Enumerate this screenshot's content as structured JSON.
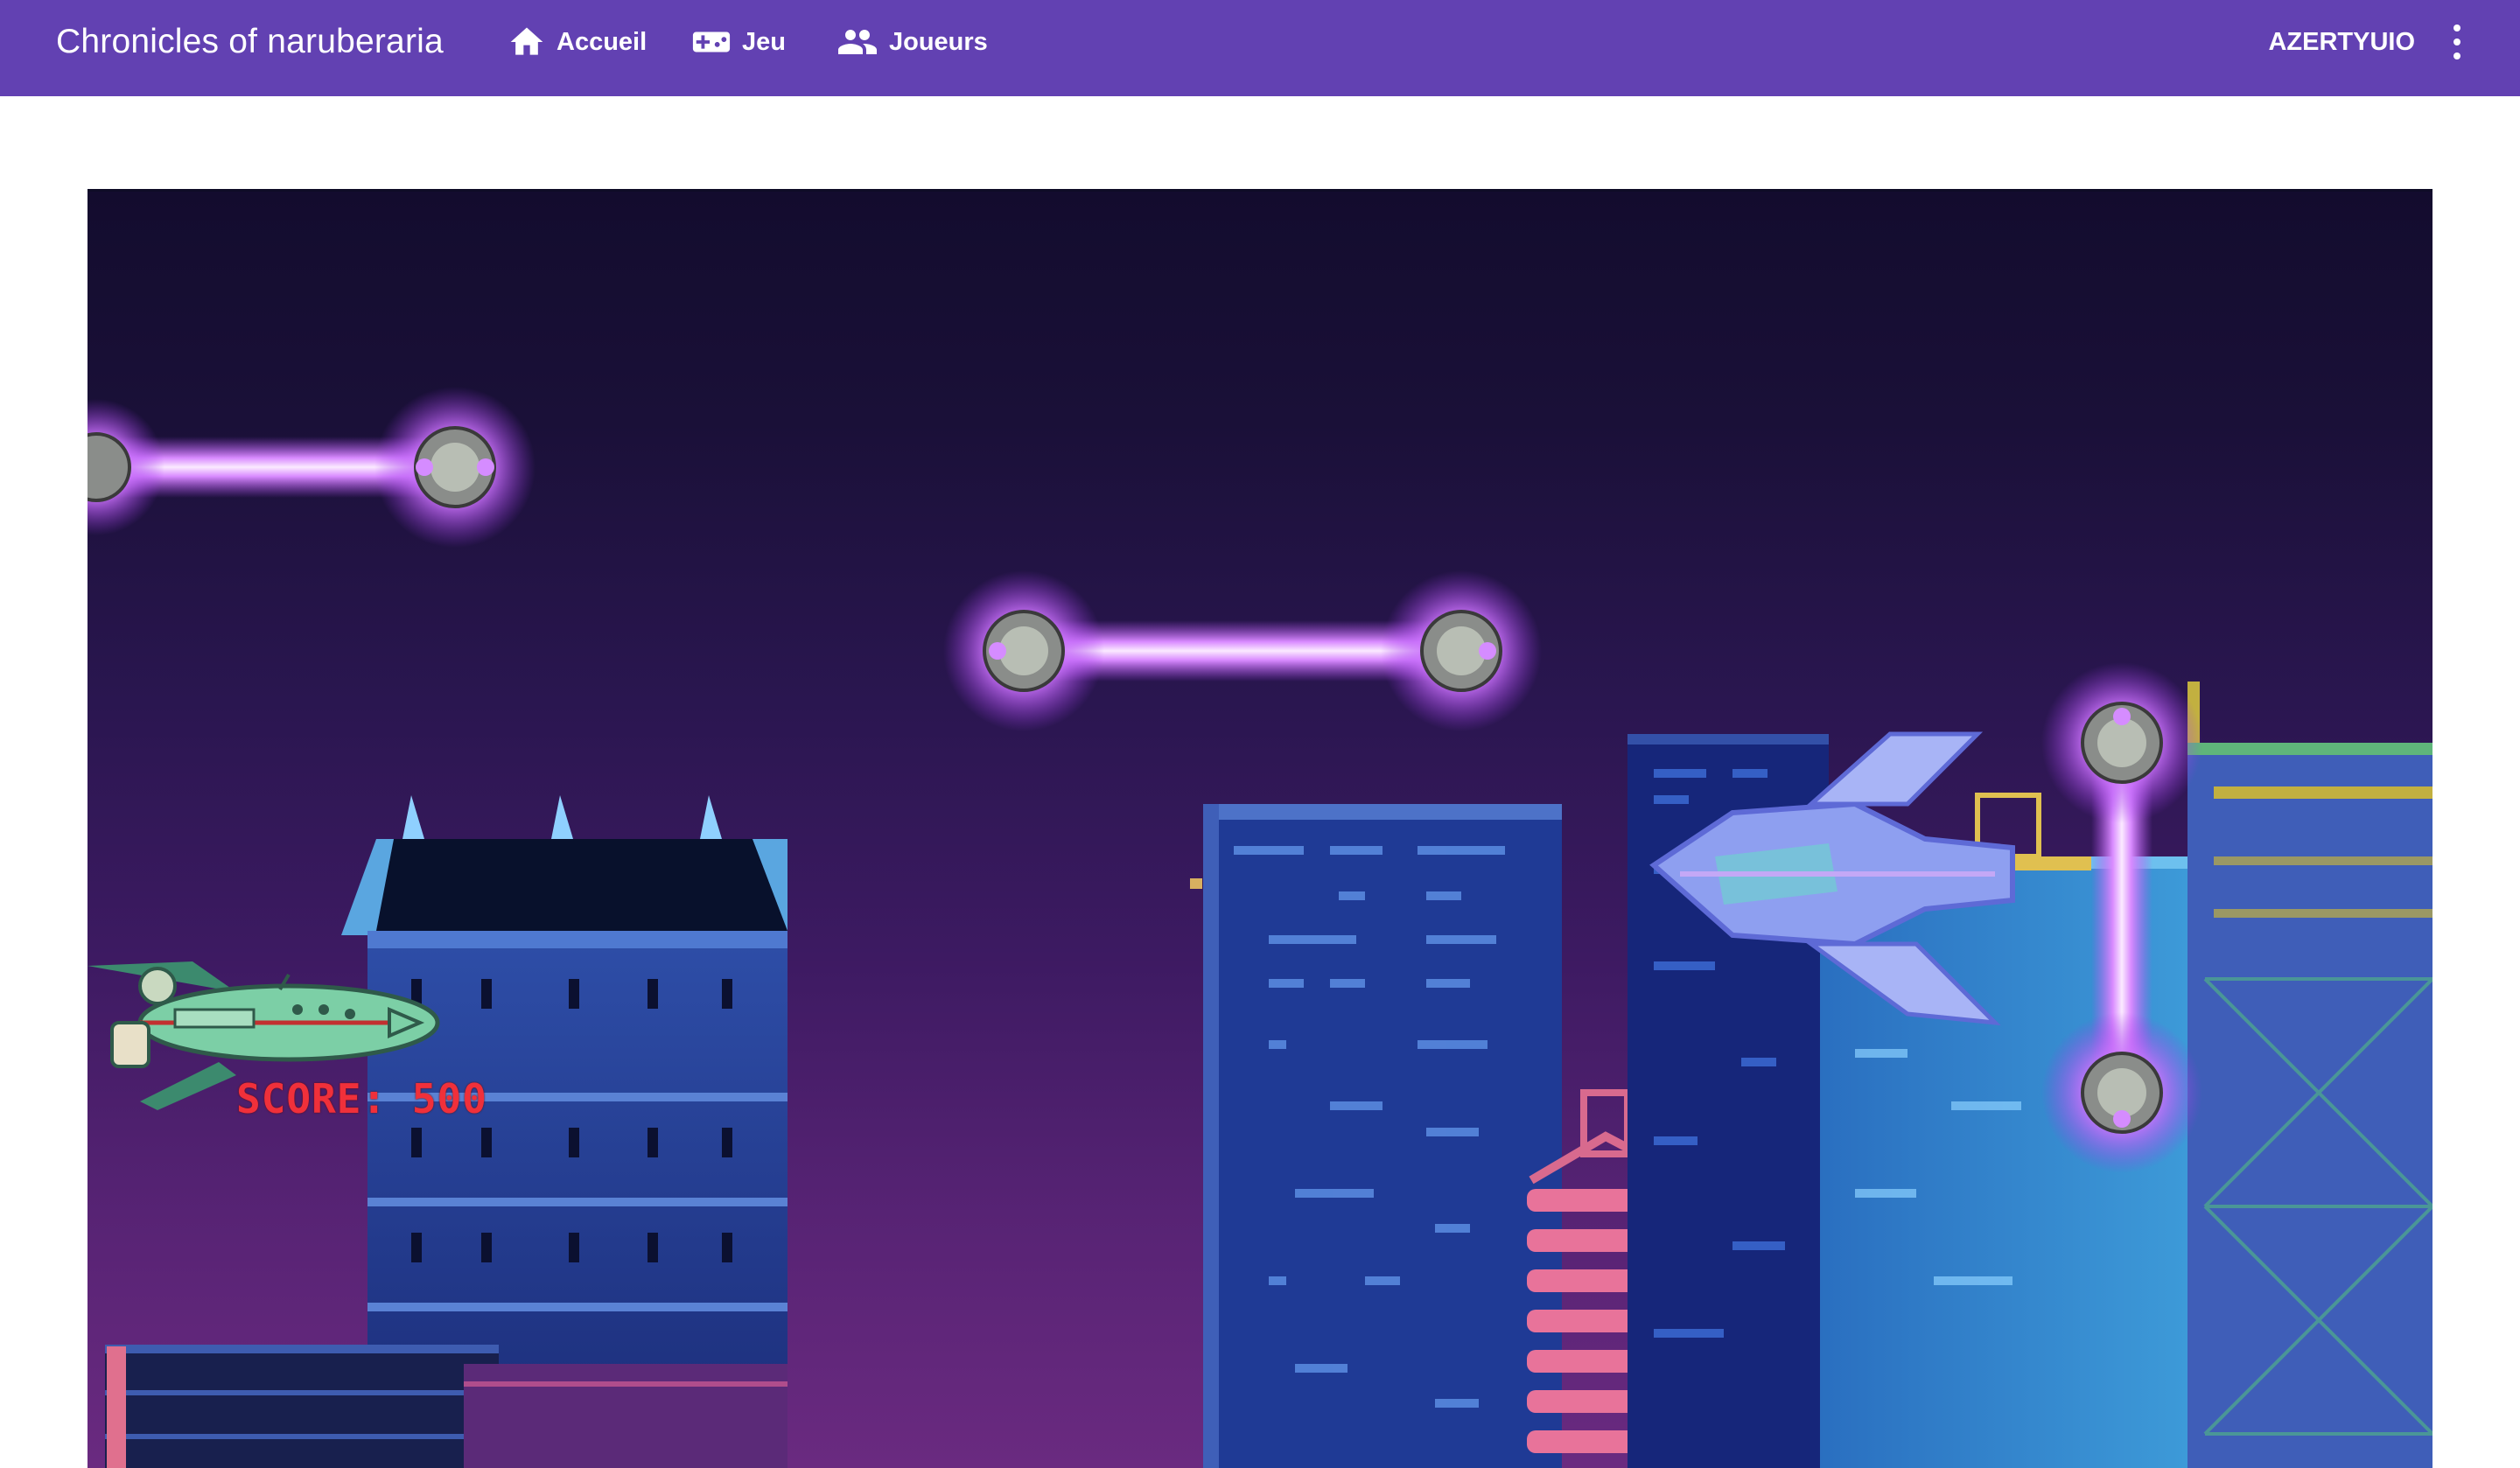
{
  "toolbar": {
    "brand": "Chronicles of naruberaria",
    "nav": [
      {
        "label": "Accueil",
        "icon": "home-icon"
      },
      {
        "label": "Jeu",
        "icon": "gamepad-icon"
      },
      {
        "label": "Joueurs",
        "icon": "people-icon"
      }
    ],
    "user": "AZERTYUIO",
    "menu_icon": "more-vert-icon",
    "color": "#6241b2"
  },
  "game": {
    "score_text": "SCORE: 500",
    "score_color": "#f0303a",
    "player": "spaceship-player",
    "enemy": "spaceship-enemy",
    "obstacles": [
      "plasma-barrier",
      "plasma-barrier",
      "plasma-barrier"
    ]
  }
}
